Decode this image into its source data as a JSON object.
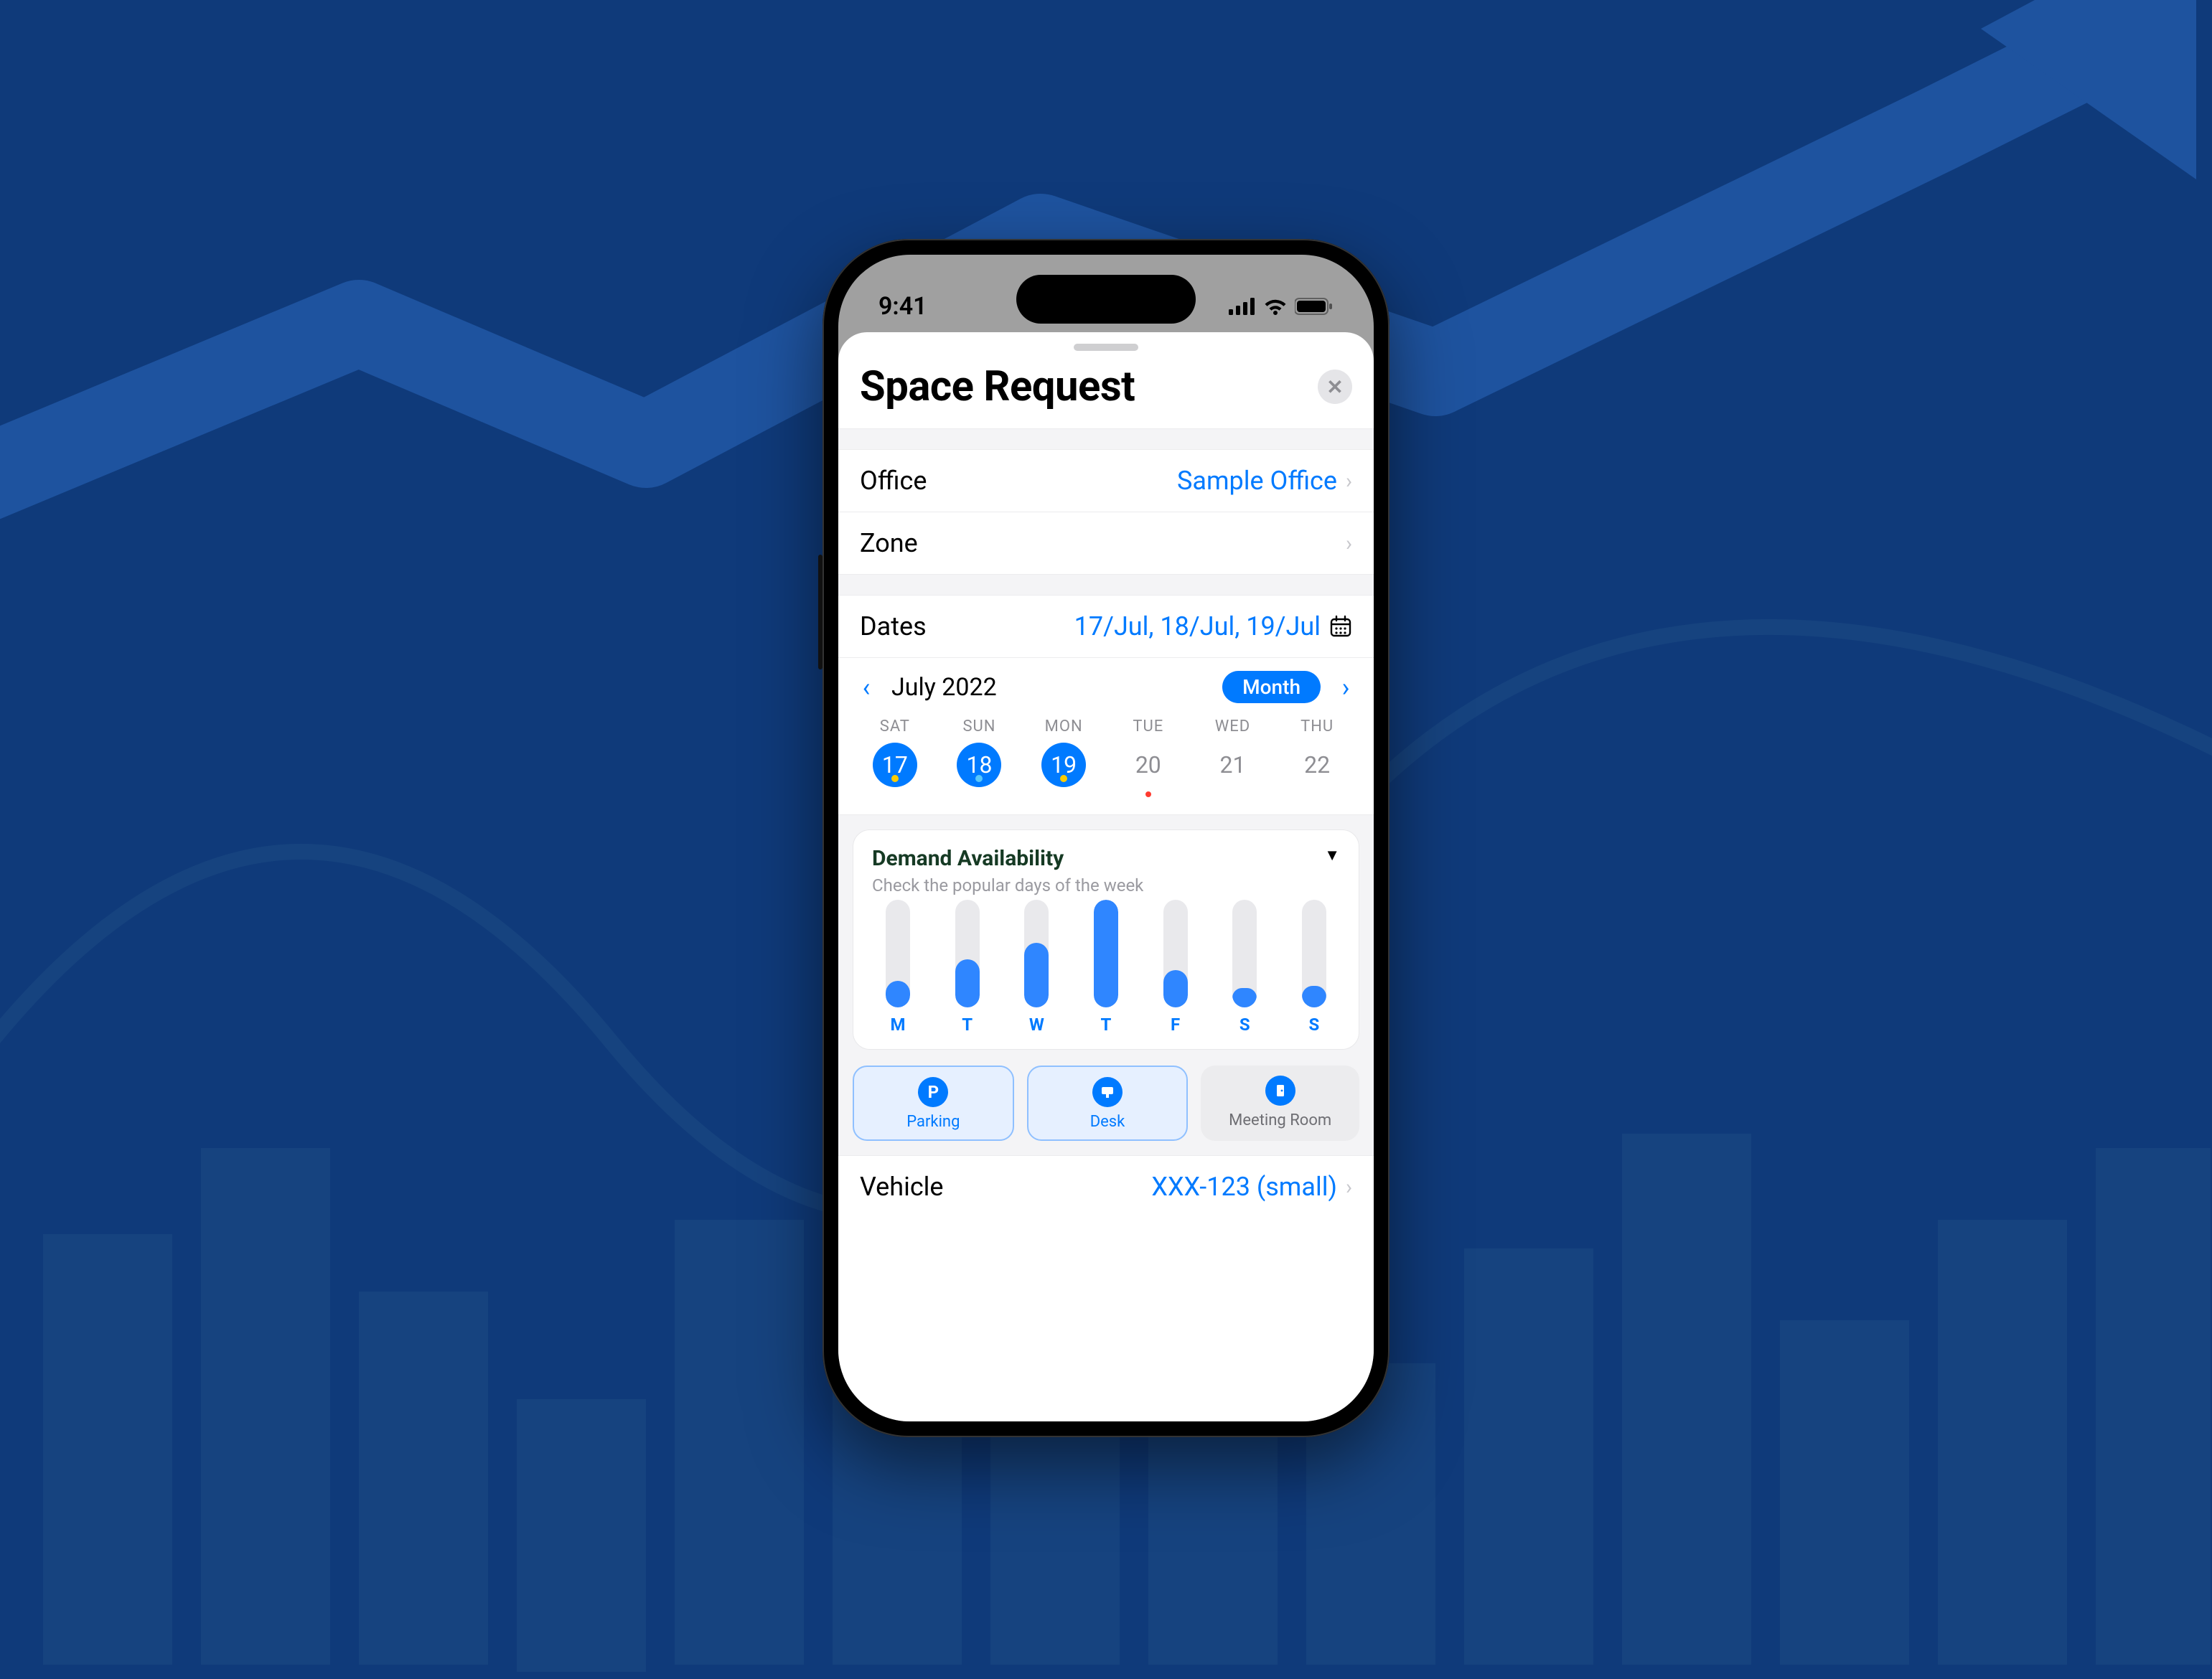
{
  "status": {
    "time": "9:41"
  },
  "sheet": {
    "title": "Space Request"
  },
  "rows": {
    "office": {
      "label": "Office",
      "value": "Sample Office"
    },
    "zone": {
      "label": "Zone",
      "value": ""
    },
    "dates": {
      "label": "Dates",
      "value": "17/Jul, 18/Jul, 19/Jul"
    },
    "vehicle": {
      "label": "Vehicle",
      "value": "XXX-123 (small)"
    }
  },
  "monthNav": {
    "label": "July 2022",
    "pill": "Month"
  },
  "week": [
    {
      "dow": "SAT",
      "num": "17",
      "selected": true,
      "dot": "yellow"
    },
    {
      "dow": "SUN",
      "num": "18",
      "selected": true,
      "dot": "blue"
    },
    {
      "dow": "MON",
      "num": "19",
      "selected": true,
      "dot": "yellow"
    },
    {
      "dow": "TUE",
      "num": "20",
      "selected": false,
      "dot": "red"
    },
    {
      "dow": "WED",
      "num": "21",
      "selected": false,
      "dot": ""
    },
    {
      "dow": "THU",
      "num": "22",
      "selected": false,
      "dot": ""
    }
  ],
  "demand": {
    "title": "Demand Availability",
    "subtitle": "Check the popular days of the week"
  },
  "chart_data": {
    "type": "bar",
    "title": "Demand Availability",
    "categories": [
      "M",
      "T",
      "W",
      "T",
      "F",
      "S",
      "S"
    ],
    "values": [
      25,
      45,
      60,
      100,
      35,
      18,
      20
    ],
    "ylim": [
      0,
      100
    ],
    "xlabel": "",
    "ylabel": ""
  },
  "types": {
    "parking": "Parking",
    "desk": "Desk",
    "meeting": "Meeting Room"
  }
}
